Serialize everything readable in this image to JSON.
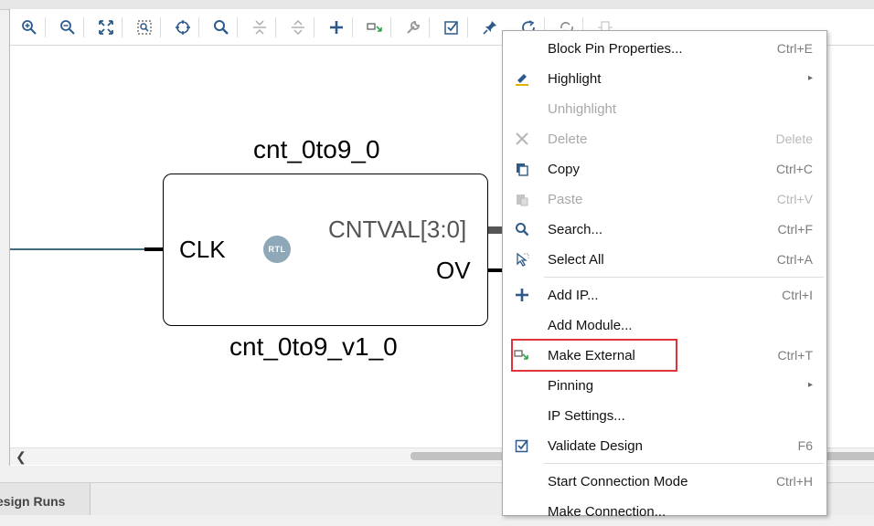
{
  "block": {
    "instance_name": "cnt_0to9_0",
    "module_name": "cnt_0to9_v1_0",
    "badge": "RTL",
    "pins": {
      "input": "CLK",
      "output_bus": "CNTVAL[3:0]",
      "output": "OV"
    }
  },
  "toolbar": {
    "buttons": [
      "zoom-in-icon",
      "zoom-out-icon",
      "zoom-fit-icon",
      "zoom-area-icon",
      "crosshair-icon",
      "search-icon",
      "collapse-icon",
      "expand-icon",
      "add-icon",
      "make-external-icon",
      "wrench-icon",
      "validate-icon",
      "pin-icon",
      "refresh-icon",
      "regenerate-icon",
      "port-icon"
    ]
  },
  "context_menu": {
    "items": [
      {
        "label": "Block Pin Properties...",
        "shortcut": "Ctrl+E",
        "icon": "",
        "enabled": true
      },
      {
        "label": "Highlight",
        "shortcut": "",
        "icon": "highlight-icon",
        "enabled": true,
        "submenu": true
      },
      {
        "label": "Unhighlight",
        "shortcut": "",
        "icon": "",
        "enabled": false
      },
      {
        "label": "Delete",
        "shortcut": "Delete",
        "icon": "delete-icon",
        "enabled": false
      },
      {
        "label": "Copy",
        "shortcut": "Ctrl+C",
        "icon": "copy-icon",
        "enabled": true
      },
      {
        "label": "Paste",
        "shortcut": "Ctrl+V",
        "icon": "paste-icon",
        "enabled": false
      },
      {
        "label": "Search...",
        "shortcut": "Ctrl+F",
        "icon": "search-icon",
        "enabled": true
      },
      {
        "label": "Select All",
        "shortcut": "Ctrl+A",
        "icon": "select-all-icon",
        "enabled": true
      },
      {
        "label": "Add IP...",
        "shortcut": "Ctrl+I",
        "icon": "add-icon",
        "enabled": true
      },
      {
        "label": "Add Module...",
        "shortcut": "",
        "icon": "",
        "enabled": true
      },
      {
        "label": "Make External",
        "shortcut": "Ctrl+T",
        "icon": "make-external-icon",
        "enabled": true
      },
      {
        "label": "Pinning",
        "shortcut": "",
        "icon": "",
        "enabled": true,
        "submenu": true
      },
      {
        "label": "IP Settings...",
        "shortcut": "",
        "icon": "",
        "enabled": true
      },
      {
        "label": "Validate Design",
        "shortcut": "F6",
        "icon": "validate-icon",
        "enabled": true
      },
      {
        "label": "Start Connection Mode",
        "shortcut": "Ctrl+H",
        "icon": "",
        "enabled": true
      },
      {
        "label": "Make Connection...",
        "shortcut": "",
        "icon": "",
        "enabled": true
      }
    ],
    "submenu_arrow": "▸"
  },
  "bottom_tabs": {
    "design_runs": "esign Runs"
  },
  "colors": {
    "accent_blue": "#2d5a8a",
    "highlight_red": "#e0333a",
    "net_color": "#3f6b7a",
    "make_external_green": "#2aa84a"
  }
}
